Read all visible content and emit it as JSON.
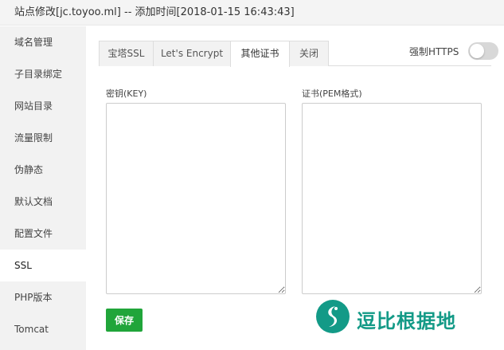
{
  "window": {
    "title": "站点修改[jc.toyoo.ml] -- 添加时间[2018-01-15 16:43:43]"
  },
  "sidebar": {
    "items": [
      {
        "label": "域名管理"
      },
      {
        "label": "子目录绑定"
      },
      {
        "label": "网站目录"
      },
      {
        "label": "流量限制"
      },
      {
        "label": "伪静态"
      },
      {
        "label": "默认文档"
      },
      {
        "label": "配置文件"
      },
      {
        "label": "SSL",
        "active": true
      },
      {
        "label": "PHP版本"
      },
      {
        "label": "Tomcat"
      }
    ]
  },
  "tabs": [
    {
      "label": "宝塔SSL"
    },
    {
      "label": "Let's Encrypt"
    },
    {
      "label": "其他证书",
      "active": true
    },
    {
      "label": "关闭"
    }
  ],
  "https_toggle": {
    "label": "强制HTTPS",
    "enabled": false
  },
  "form": {
    "key_label": "密钥(KEY)",
    "key_value": "",
    "cert_label": "证书(PEM格式)",
    "cert_value": "",
    "save_label": "保存"
  },
  "watermark": {
    "text": "逗比根据地"
  },
  "colors": {
    "accent": "#20a53a",
    "watermark": "#139a87",
    "sidebar_bg": "#f2f2f2"
  }
}
